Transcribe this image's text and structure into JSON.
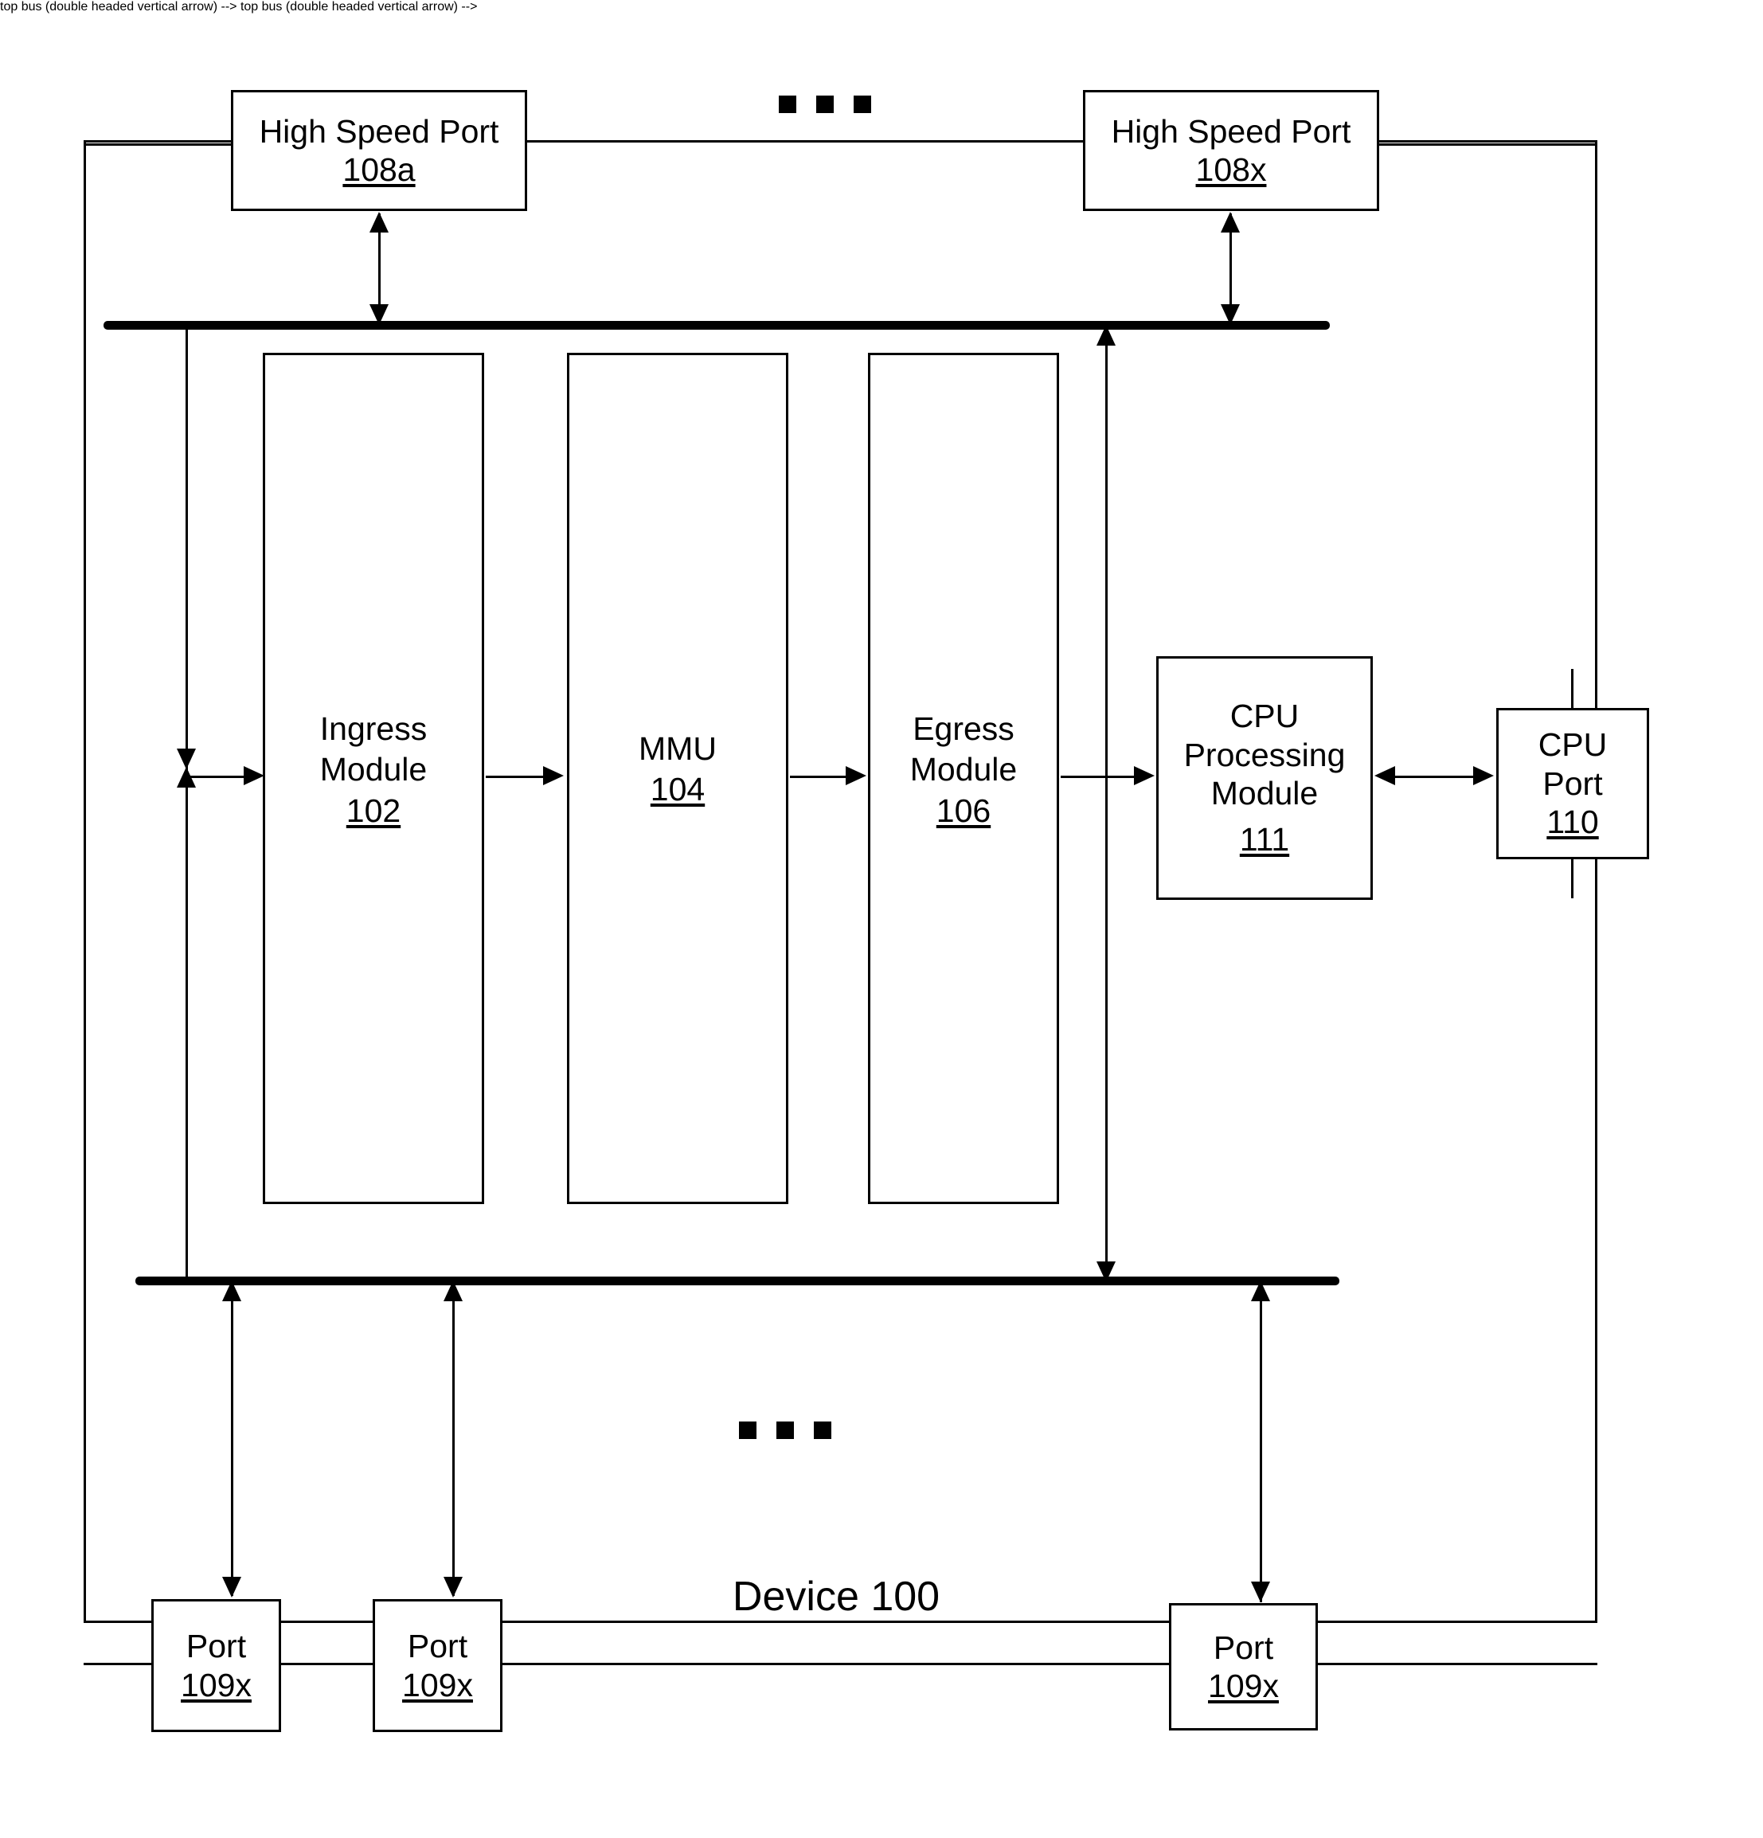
{
  "diagram": {
    "figure_label": "Device 100",
    "device_label": "Device 100",
    "ellipsis_top": "• • •",
    "ellipsis_bottom": "• • •",
    "nodes": {
      "hsp_a": {
        "title": "High Speed Port",
        "ref": "108a"
      },
      "hsp_x": {
        "title": "High Speed Port",
        "ref": "108x"
      },
      "ingress": {
        "title": "Ingress\nModule",
        "ref": "102"
      },
      "mmu": {
        "title": "MMU",
        "ref": "104"
      },
      "egress": {
        "title": "Egress\nModule",
        "ref": "106"
      },
      "cpu_processing": {
        "title": "CPU\nProcessing\nModule",
        "ref": "111"
      },
      "cpu_port": {
        "title": "CPU\nPort",
        "ref": "110"
      },
      "port_1": {
        "title": "Port",
        "ref": "109x"
      },
      "port_2": {
        "title": "Port",
        "ref": "109x"
      },
      "port_3": {
        "title": "Port",
        "ref": "109x"
      }
    },
    "colors": {
      "stroke": "#000000",
      "background": "#ffffff"
    }
  }
}
